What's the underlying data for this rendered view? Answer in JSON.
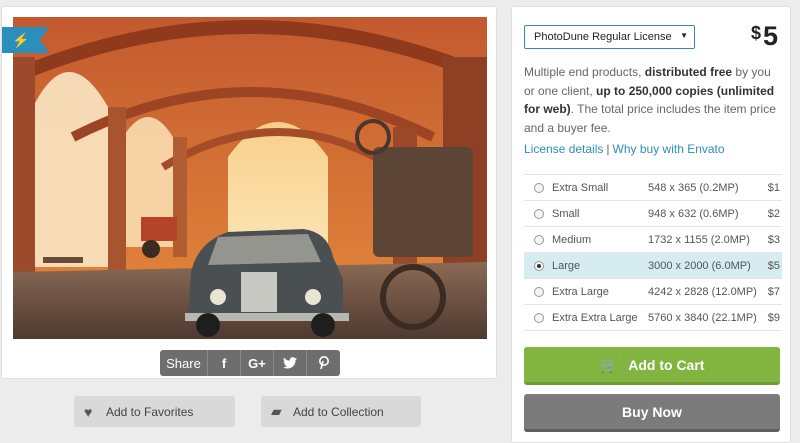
{
  "preview": {
    "image_alt": "Vintage car under brick arches",
    "badge_icon": "lightning-icon"
  },
  "share": {
    "label": "Share",
    "buttons": [
      {
        "name": "facebook",
        "glyph": "f"
      },
      {
        "name": "google-plus",
        "glyph": "G+"
      },
      {
        "name": "twitter",
        "glyph": "🐦"
      },
      {
        "name": "pinterest",
        "glyph": "℗"
      }
    ]
  },
  "actions": {
    "favorites_label": "Add to Favorites",
    "collection_label": "Add to Collection"
  },
  "license": {
    "selected": "PhotoDune Regular License",
    "price_currency": "$",
    "price_value": "5",
    "desc_1": "Multiple end products, ",
    "desc_bold_1": "distributed free",
    "desc_2": " by you or one client, ",
    "desc_bold_2": "up to 250,000 copies (unlimited for web)",
    "desc_3": ". The total price includes the item price and a buyer fee.",
    "link_details": "License details",
    "link_separator": "|",
    "link_why": "Why buy with Envato"
  },
  "sizes": [
    {
      "name": "Extra Small",
      "dims": "548 x 365 (0.2MP)",
      "price": "$1",
      "selected": false
    },
    {
      "name": "Small",
      "dims": "948 x 632 (0.6MP)",
      "price": "$2",
      "selected": false
    },
    {
      "name": "Medium",
      "dims": "1732 x 1155 (2.0MP)",
      "price": "$3",
      "selected": false
    },
    {
      "name": "Large",
      "dims": "3000 x 2000 (6.0MP)",
      "price": "$5",
      "selected": true
    },
    {
      "name": "Extra Large",
      "dims": "4242 x 2828 (12.0MP)",
      "price": "$7",
      "selected": false
    },
    {
      "name": "Extra Extra Large",
      "dims": "5760 x 3840 (22.1MP)",
      "price": "$9",
      "selected": false
    }
  ],
  "buttons": {
    "add_to_cart": "Add to Cart",
    "buy_now": "Buy Now"
  },
  "colors": {
    "accent": "#2a8fbd",
    "cart_green": "#82b440",
    "buy_gray": "#7b7b7b",
    "selected_row": "#d7ecf0"
  }
}
